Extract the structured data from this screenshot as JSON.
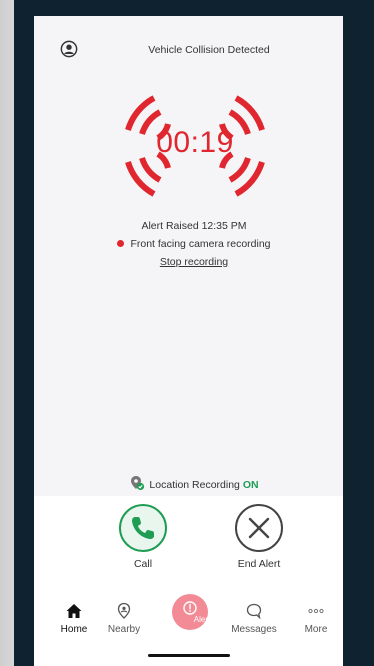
{
  "screen": {
    "title": "Vehicle Collision Detected",
    "timer": "00:19",
    "alert_raised": "Alert Raised 12:35 PM",
    "camera_status": "Front facing camera recording",
    "stop_recording": "Stop recording",
    "location_label": "Location Recording",
    "location_state": "ON"
  },
  "actions": {
    "call_label": "Call",
    "end_label": "End Alert"
  },
  "tabs": [
    {
      "label": "Home",
      "icon": "home-icon"
    },
    {
      "label": "Nearby",
      "icon": "location-pin-icon"
    },
    {
      "label": "Alert",
      "icon": "alert-icon"
    },
    {
      "label": "Messages",
      "icon": "chat-bubble-icon"
    },
    {
      "label": "More",
      "icon": "more-dots-icon"
    }
  ],
  "colors": {
    "accent_red": "#e0262e",
    "green": "#1f9d55",
    "alert_pink": "#f28b95",
    "device_bg": "#0e2230"
  }
}
